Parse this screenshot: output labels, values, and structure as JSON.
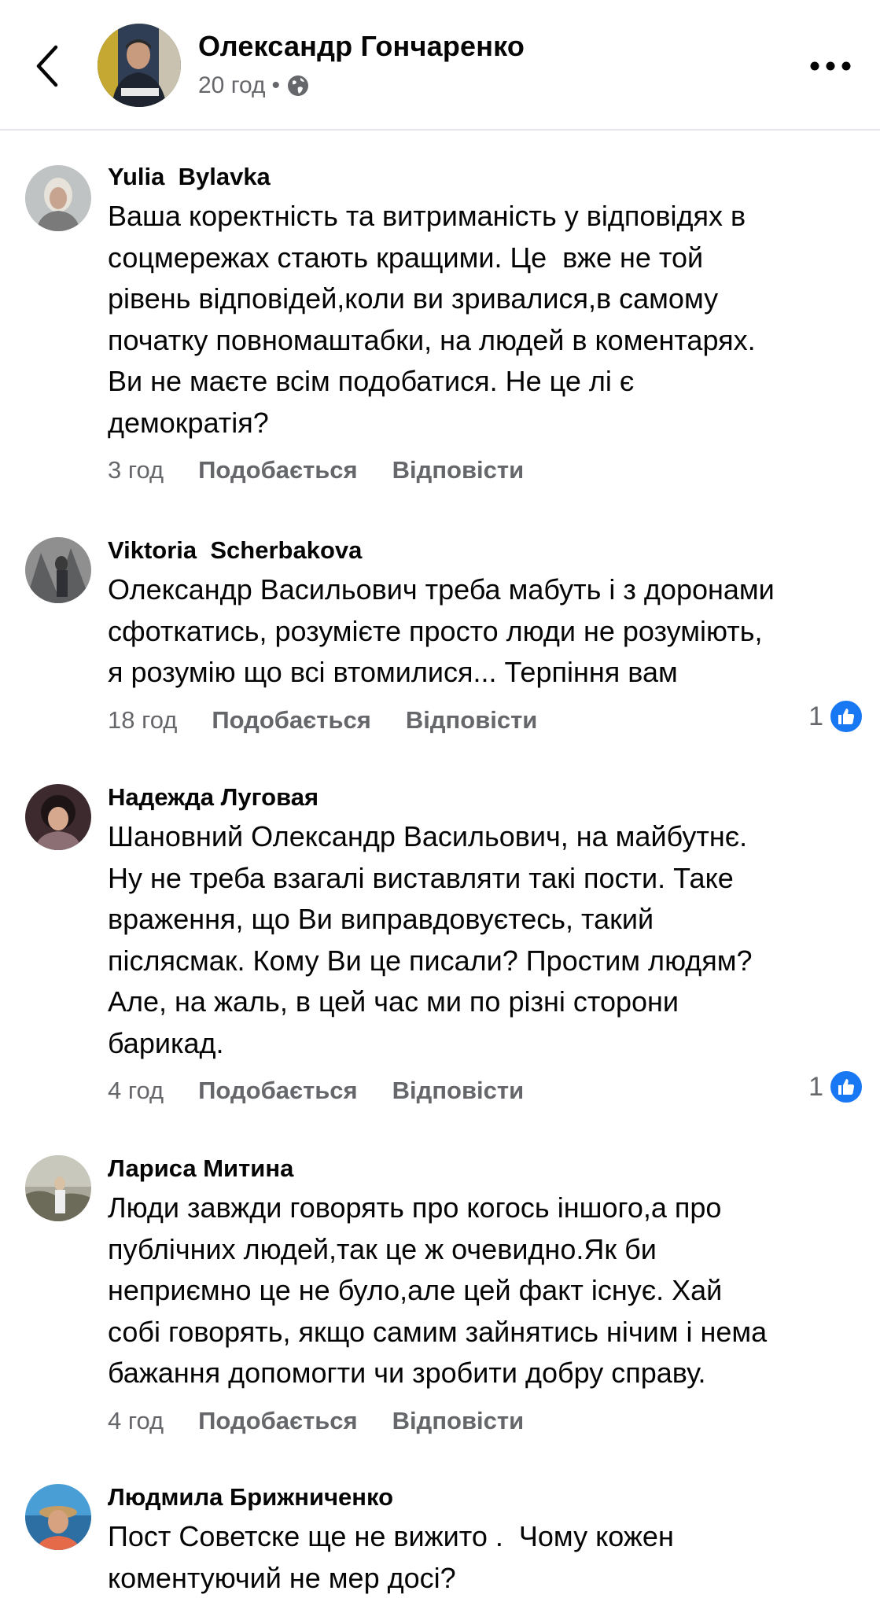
{
  "header": {
    "author": "Олександр Гончаренко",
    "time": "20 год",
    "separator": "•",
    "privacy_icon": "globe-icon"
  },
  "comments": [
    {
      "author": "Yulia  Bylavka",
      "text": "Ваша коректність та витриманість у відповідях в\nсоцмережах стають кращими. Це  вже не той\nрівень відповідей,коли ви зривалися,в самому\nпочатку повномаштабки, на людей в коментарях.\nВи не маєте всім подобатися. Не це лі є\nдемократія?",
      "time": "3 год",
      "like_label": "Подобається",
      "reply_label": "Відповісти",
      "reactions": null
    },
    {
      "author": "Viktoria  Scherbakova",
      "text": "Олександр Васильович треба мабуть і з доронами\nсфоткатись, розумієте просто люди не розуміють,\nя розумію що всі втомилися... Терпіння вам",
      "time": "18 год",
      "like_label": "Подобається",
      "reply_label": "Відповісти",
      "reactions": "1"
    },
    {
      "author": "Надежда Луговая",
      "text": "Шановний Олександр Васильович, на майбутнє.\nНу не треба взагалі виставляти такі пости. Таке\nвраження, що Ви виправдовуєтесь, такий\nпіслясмак. Кому Ви це писали? Простим людям?\nАле, на жаль, в цей час ми по різні сторони\nбарикад.",
      "time": "4 год",
      "like_label": "Подобається",
      "reply_label": "Відповісти",
      "reactions": "1"
    },
    {
      "author": "Лариса Митина",
      "text": "Люди завжди говорять про когось іншого,а про\nпублічних людей,так це ж очевидно.Як би\nнеприємно це не було,але цей факт існує. Хай\nсобі говорять, якщо самим зайнятись нічим і нема\nбажання допомогти чи зробити добру справу.",
      "time": "4 год",
      "like_label": "Подобається",
      "reply_label": "Відповісти",
      "reactions": null
    },
    {
      "author": "Людмила Брижниченко",
      "text": "Пост Советске ще не вижито .  Чому кожен\nкоментуючий не мер досі?",
      "time": "",
      "like_label": "",
      "reply_label": "",
      "reactions": null
    }
  ],
  "colors": {
    "text_primary": "#050505",
    "text_secondary": "#65676b",
    "like_blue": "#1877f2",
    "divider": "#e4e6eb"
  }
}
